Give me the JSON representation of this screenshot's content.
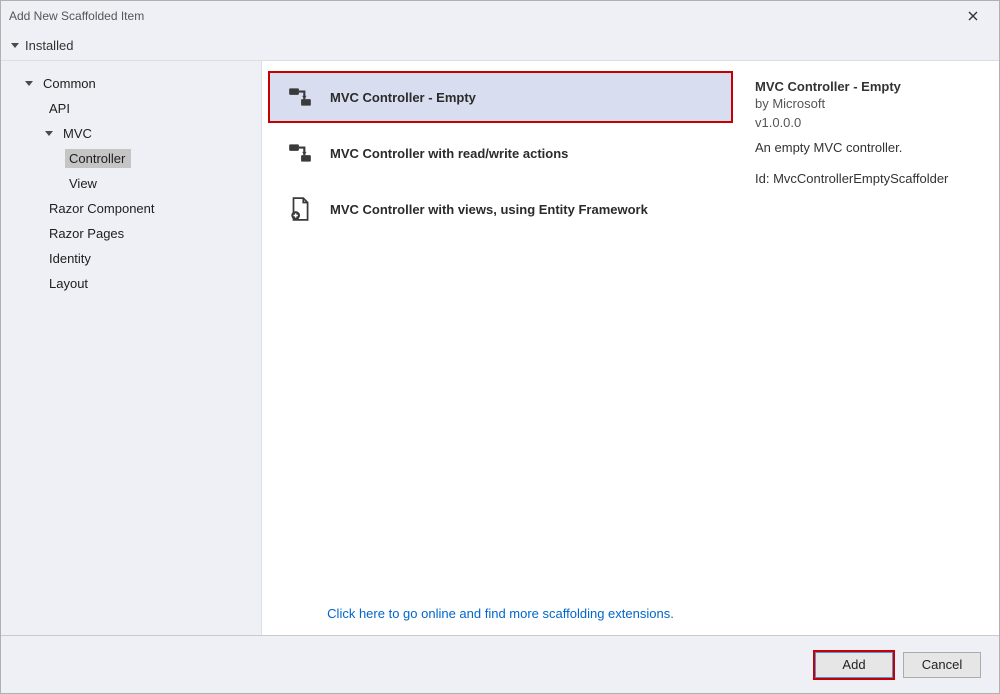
{
  "window": {
    "title": "Add New Scaffolded Item"
  },
  "tabs": {
    "installed": "Installed"
  },
  "tree": {
    "common": "Common",
    "api": "API",
    "mvc": "MVC",
    "controller": "Controller",
    "view": "View",
    "razor_component": "Razor Component",
    "razor_pages": "Razor Pages",
    "identity": "Identity",
    "layout": "Layout"
  },
  "templates": [
    {
      "label": "MVC Controller - Empty",
      "selected": true
    },
    {
      "label": "MVC Controller with read/write actions",
      "selected": false
    },
    {
      "label": "MVC Controller with views, using Entity Framework",
      "selected": false
    }
  ],
  "footer_link": "Click here to go online and find more scaffolding extensions.",
  "details": {
    "title": "MVC Controller - Empty",
    "author": "by Microsoft",
    "version": "v1.0.0.0",
    "description": "An empty MVC controller.",
    "id_label": "Id: MvcControllerEmptyScaffolder"
  },
  "buttons": {
    "add": "Add",
    "cancel": "Cancel"
  }
}
